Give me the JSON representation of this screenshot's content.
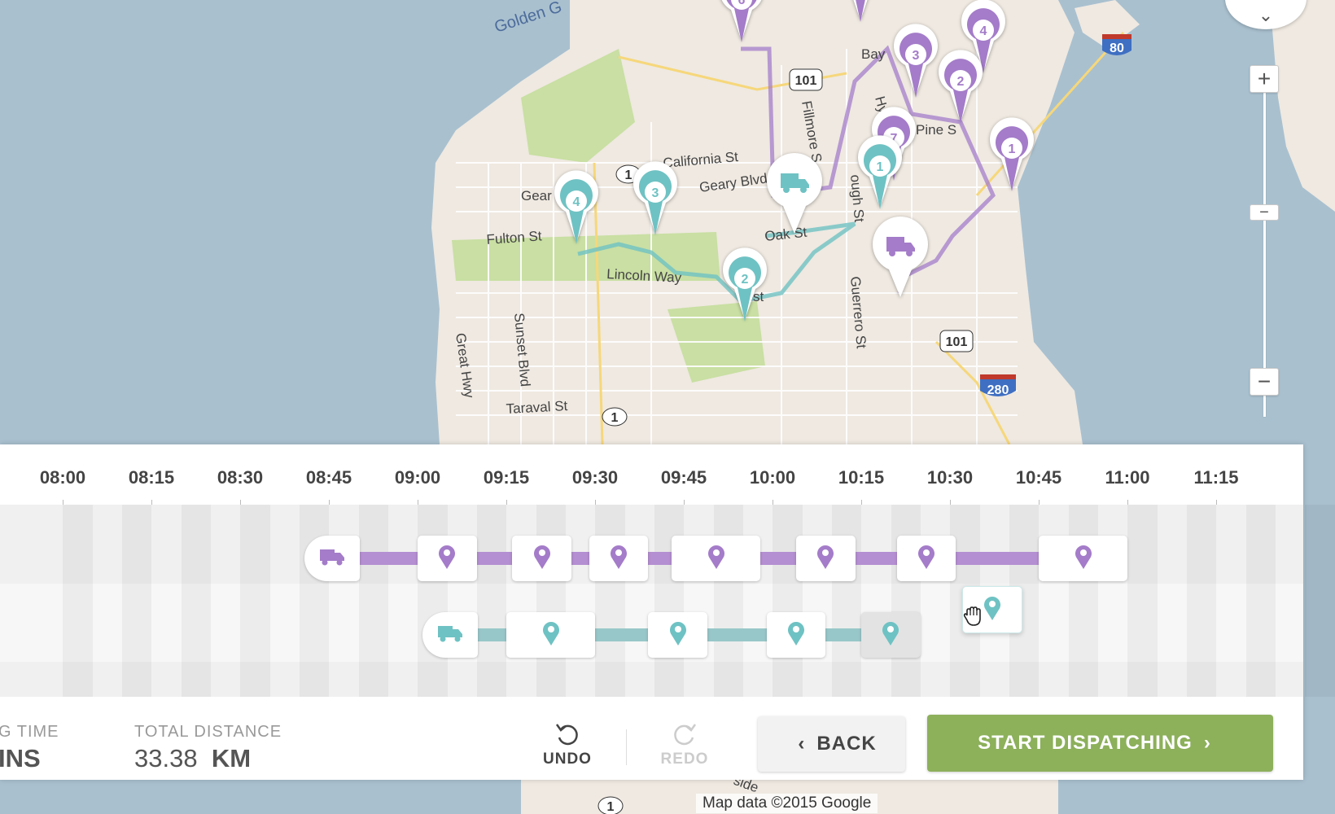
{
  "map": {
    "street_labels": [
      "Golden G",
      "Bay",
      "Hyd",
      "Pine S",
      "California St",
      "Geary Blvd",
      "Gear",
      "Fulton St",
      "Fillmore S",
      "ough St",
      "Oak St",
      "Lincoln Way",
      "Sunset Blvd",
      "Great Hwy",
      "Guerrero St",
      "Taraval St",
      "st",
      "side"
    ],
    "route_shields": [
      "101",
      "101",
      "80",
      "280",
      "1",
      "1",
      "1"
    ],
    "purple_markers": [
      "6",
      "",
      "4",
      "3",
      "2",
      "7",
      "1"
    ],
    "teal_markers": [
      "4",
      "3",
      "1",
      "2"
    ],
    "credit": "Map data ©2015 Google",
    "zoom_in": "+",
    "zoom_out": "−",
    "zoom_mid": "−",
    "compass_glyph": "⌄"
  },
  "timeline": {
    "times": [
      "08:00",
      "08:15",
      "08:30",
      "08:45",
      "09:00",
      "09:15",
      "09:30",
      "09:45",
      "10:00",
      "10:15",
      "10:30",
      "10:45",
      "11:00",
      "11:15"
    ],
    "routes": [
      {
        "name": "purple",
        "color": "#a47cc9",
        "start": "08:45",
        "stops": [
          {
            "start": "09:00",
            "end": "09:10"
          },
          {
            "start": "09:16",
            "end": "09:26"
          },
          {
            "start": "09:29",
            "end": "09:39"
          },
          {
            "start": "09:43",
            "end": "09:58"
          },
          {
            "start": "10:04",
            "end": "10:14"
          },
          {
            "start": "10:21",
            "end": "10:31"
          },
          {
            "start": "10:45",
            "end": "11:00"
          }
        ]
      },
      {
        "name": "teal",
        "color": "#6fc2c3",
        "start": "09:05",
        "stops": [
          {
            "start": "09:15",
            "end": "09:30"
          },
          {
            "start": "09:39",
            "end": "09:49"
          },
          {
            "start": "09:59",
            "end": "10:09"
          },
          {
            "start": "10:15",
            "end": "10:25",
            "state": "unassigned"
          }
        ]
      }
    ],
    "dragging_stop": {
      "start": "10:32",
      "end": "10:42",
      "color": "#6fc2c3"
    }
  },
  "footer": {
    "time_label": "G TIME",
    "time_value": "INS",
    "distance_label": "TOTAL DISTANCE",
    "distance_value": "33.38",
    "distance_unit": "KM",
    "undo_label": "UNDO",
    "redo_label": "REDO",
    "back_label": "BACK",
    "dispatch_label": "START DISPATCHING"
  },
  "colors": {
    "purple": "#a47cc9",
    "teal": "#6fc2c3",
    "green": "#8db05b",
    "water": "#a9c0cf",
    "park": "#c9dfa3",
    "land": "#efe9e1"
  }
}
